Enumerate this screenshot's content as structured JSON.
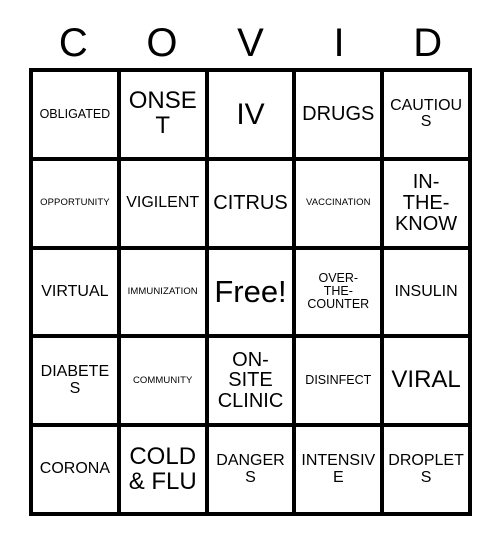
{
  "card": {
    "title_letters": [
      "C",
      "O",
      "V",
      "I",
      "D"
    ],
    "free_space_label": "Free!",
    "colors": {
      "background": "#ffffff",
      "grid_line": "#000000",
      "text": "#000000"
    },
    "rows": [
      [
        {
          "text": "OBLIGATED",
          "size": "fs-sm"
        },
        {
          "text": "ONSET",
          "size": "fs-xl"
        },
        {
          "text": "IV",
          "size": "fs-xxl"
        },
        {
          "text": "DRUGS",
          "size": "fs-lg"
        },
        {
          "text": "CAUTIOUS",
          "size": "fs-md"
        }
      ],
      [
        {
          "text": "OPPORTUNITY",
          "size": "fs-xs"
        },
        {
          "text": "VIGILENT",
          "size": "fs-md"
        },
        {
          "text": "CITRUS",
          "size": "fs-lg"
        },
        {
          "text": "VACCINATION",
          "size": "fs-xs"
        },
        {
          "text": "IN-\nTHE-\nKNOW",
          "size": "fs-lg"
        }
      ],
      [
        {
          "text": "VIRTUAL",
          "size": "fs-md"
        },
        {
          "text": "IMMUNIZATION",
          "size": "fs-xs"
        },
        {
          "text": "Free!",
          "size": "fs-free"
        },
        {
          "text": "OVER-\nTHE-\nCOUNTER",
          "size": "fs-sm"
        },
        {
          "text": "INSULIN",
          "size": "fs-md"
        }
      ],
      [
        {
          "text": "DIABETES",
          "size": "fs-md"
        },
        {
          "text": "COMMUNITY",
          "size": "fs-xs"
        },
        {
          "text": "ON-\nSITE\nCLINIC",
          "size": "fs-lg"
        },
        {
          "text": "DISINFECT",
          "size": "fs-sm"
        },
        {
          "text": "VIRAL",
          "size": "fs-xl"
        }
      ],
      [
        {
          "text": "CORONA",
          "size": "fs-md"
        },
        {
          "text": "COLD\n& FLU",
          "size": "fs-xl"
        },
        {
          "text": "DANGERS",
          "size": "fs-md"
        },
        {
          "text": "INTENSIVE",
          "size": "fs-md"
        },
        {
          "text": "DROPLETS",
          "size": "fs-md"
        }
      ]
    ]
  }
}
